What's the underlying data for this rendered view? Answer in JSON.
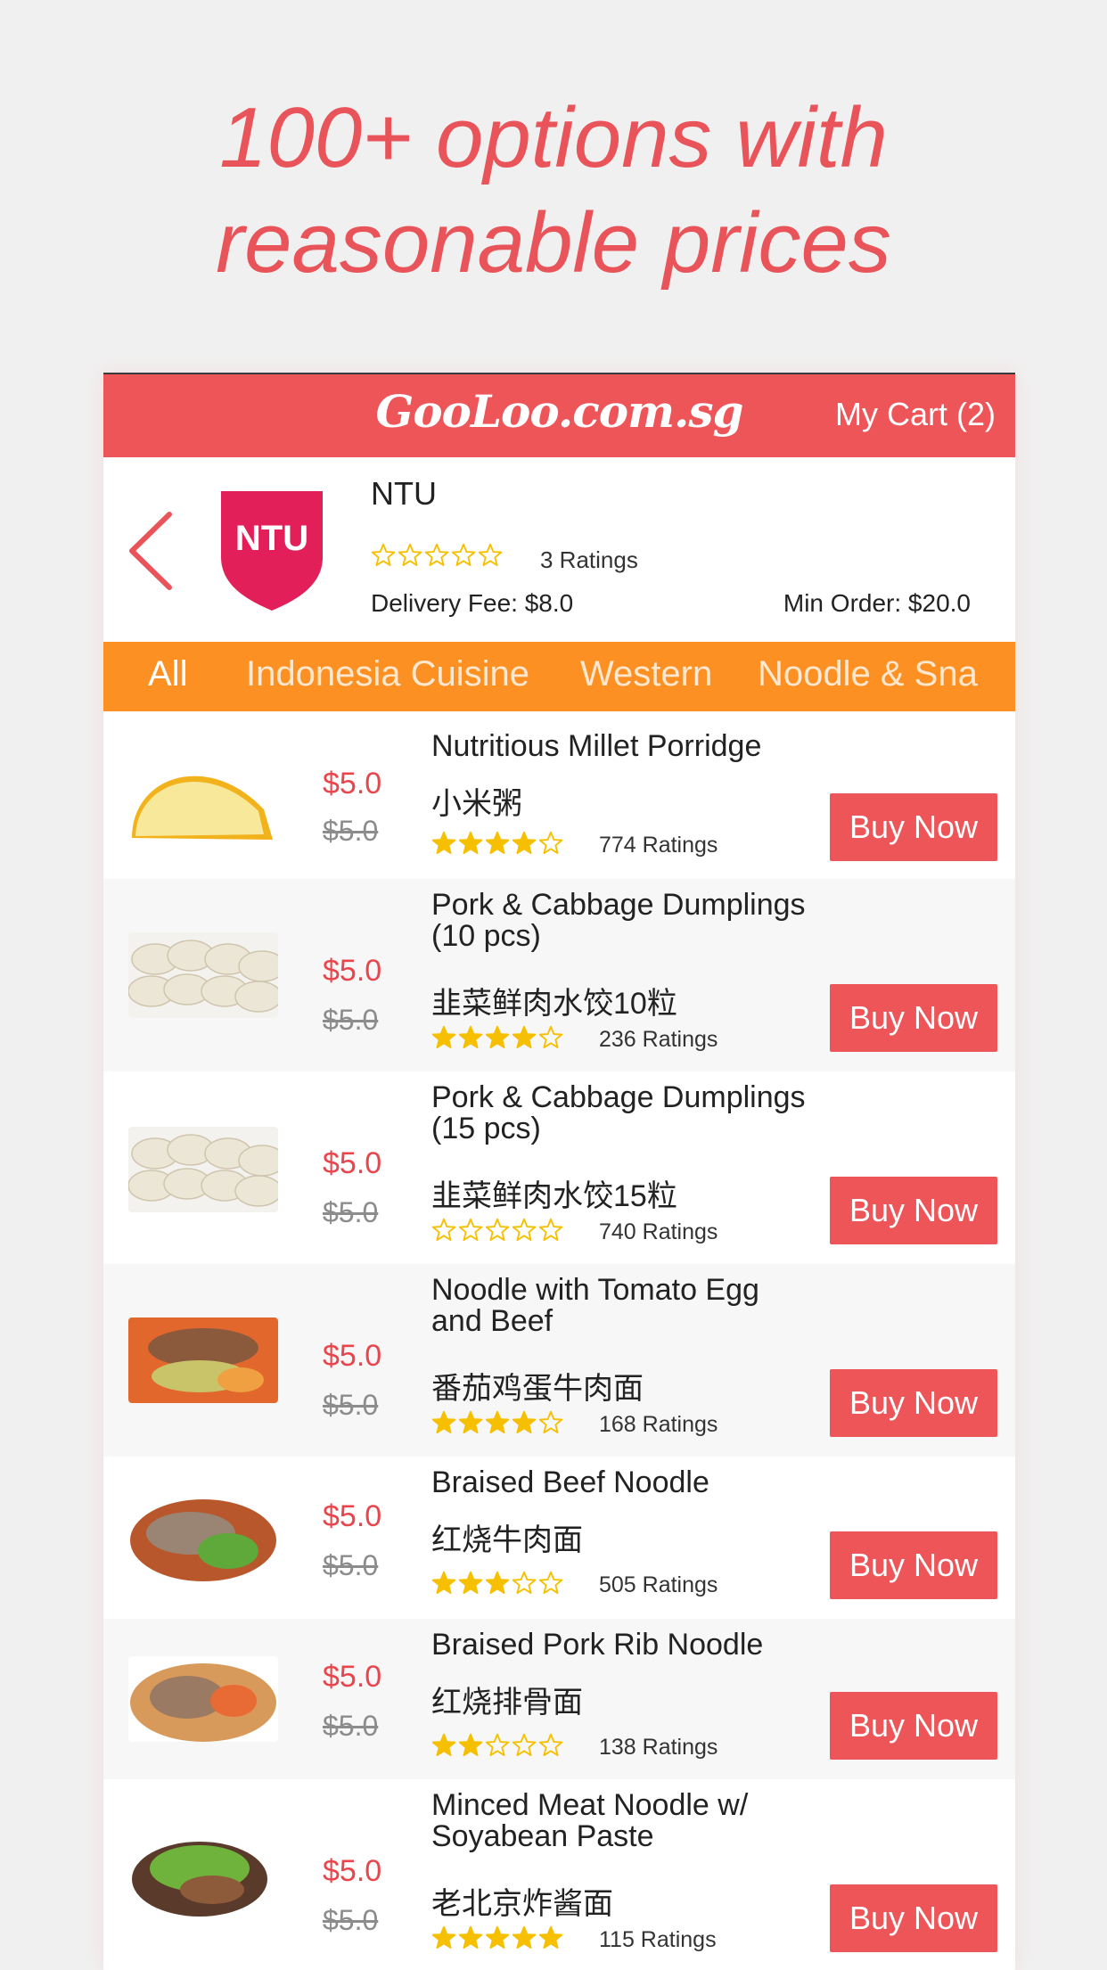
{
  "headline": {
    "line1": "100+ options with",
    "line2": "reasonable prices"
  },
  "colors": {
    "accent": "#ee5559",
    "tab_bar": "#fc9023",
    "star_filled": "#f6c000",
    "star_empty": "#f6c000"
  },
  "topbar": {
    "logo": "GooLoo.com.sg",
    "cart": "My Cart (2)"
  },
  "store": {
    "badge_text": "NTU",
    "name": "NTU",
    "rating": 0,
    "ratings_text": "3 Ratings",
    "delivery_fee": "Delivery Fee: $8.0",
    "min_order": "Min Order: $20.0",
    "back_icon": "chevron-left-icon"
  },
  "tabs": [
    "All",
    "Indonesia Cuisine",
    "Western",
    "Noodle & Sna"
  ],
  "items": [
    {
      "name": "Nutritious Millet Porridge",
      "cn": "小米粥",
      "price": "$5.0",
      "old_price": "$5.0",
      "rating": 4,
      "ratings_text": "774 Ratings",
      "buy": "Buy Now",
      "image": "porridge-image"
    },
    {
      "name": "Pork & Cabbage Dumplings (10 pcs)",
      "cn": "韭菜鲜肉水饺10粒",
      "price": "$5.0",
      "old_price": "$5.0",
      "rating": 4,
      "ratings_text": "236 Ratings",
      "buy": "Buy Now",
      "image": "dumplings-image"
    },
    {
      "name": "Pork & Cabbage Dumplings (15 pcs)",
      "cn": "韭菜鲜肉水饺15粒",
      "price": "$5.0",
      "old_price": "$5.0",
      "rating": 0,
      "ratings_text": "740 Ratings",
      "buy": "Buy Now",
      "image": "dumplings-image"
    },
    {
      "name": "Noodle with Tomato Egg and Beef",
      "cn": "番茄鸡蛋牛肉面",
      "price": "$5.0",
      "old_price": "$5.0",
      "rating": 4,
      "ratings_text": "168 Ratings",
      "buy": "Buy Now",
      "image": "tomato-noodle-image"
    },
    {
      "name": "Braised Beef Noodle",
      "cn": "红烧牛肉面",
      "price": "$5.0",
      "old_price": "$5.0",
      "rating": 3,
      "ratings_text": "505 Ratings",
      "buy": "Buy Now",
      "image": "beef-noodle-image"
    },
    {
      "name": "Braised Pork Rib Noodle",
      "cn": "红烧排骨面",
      "price": "$5.0",
      "old_price": "$5.0",
      "rating": 2,
      "ratings_text": "138 Ratings",
      "buy": "Buy Now",
      "image": "pork-rib-noodle-image"
    },
    {
      "name": "Minced Meat Noodle w/ Soyabean Paste",
      "cn": "老北京炸酱面",
      "price": "$5.0",
      "old_price": "$5.0",
      "rating": 5,
      "ratings_text": "115 Ratings",
      "buy": "Buy Now",
      "image": "zhajiang-noodle-image"
    }
  ]
}
